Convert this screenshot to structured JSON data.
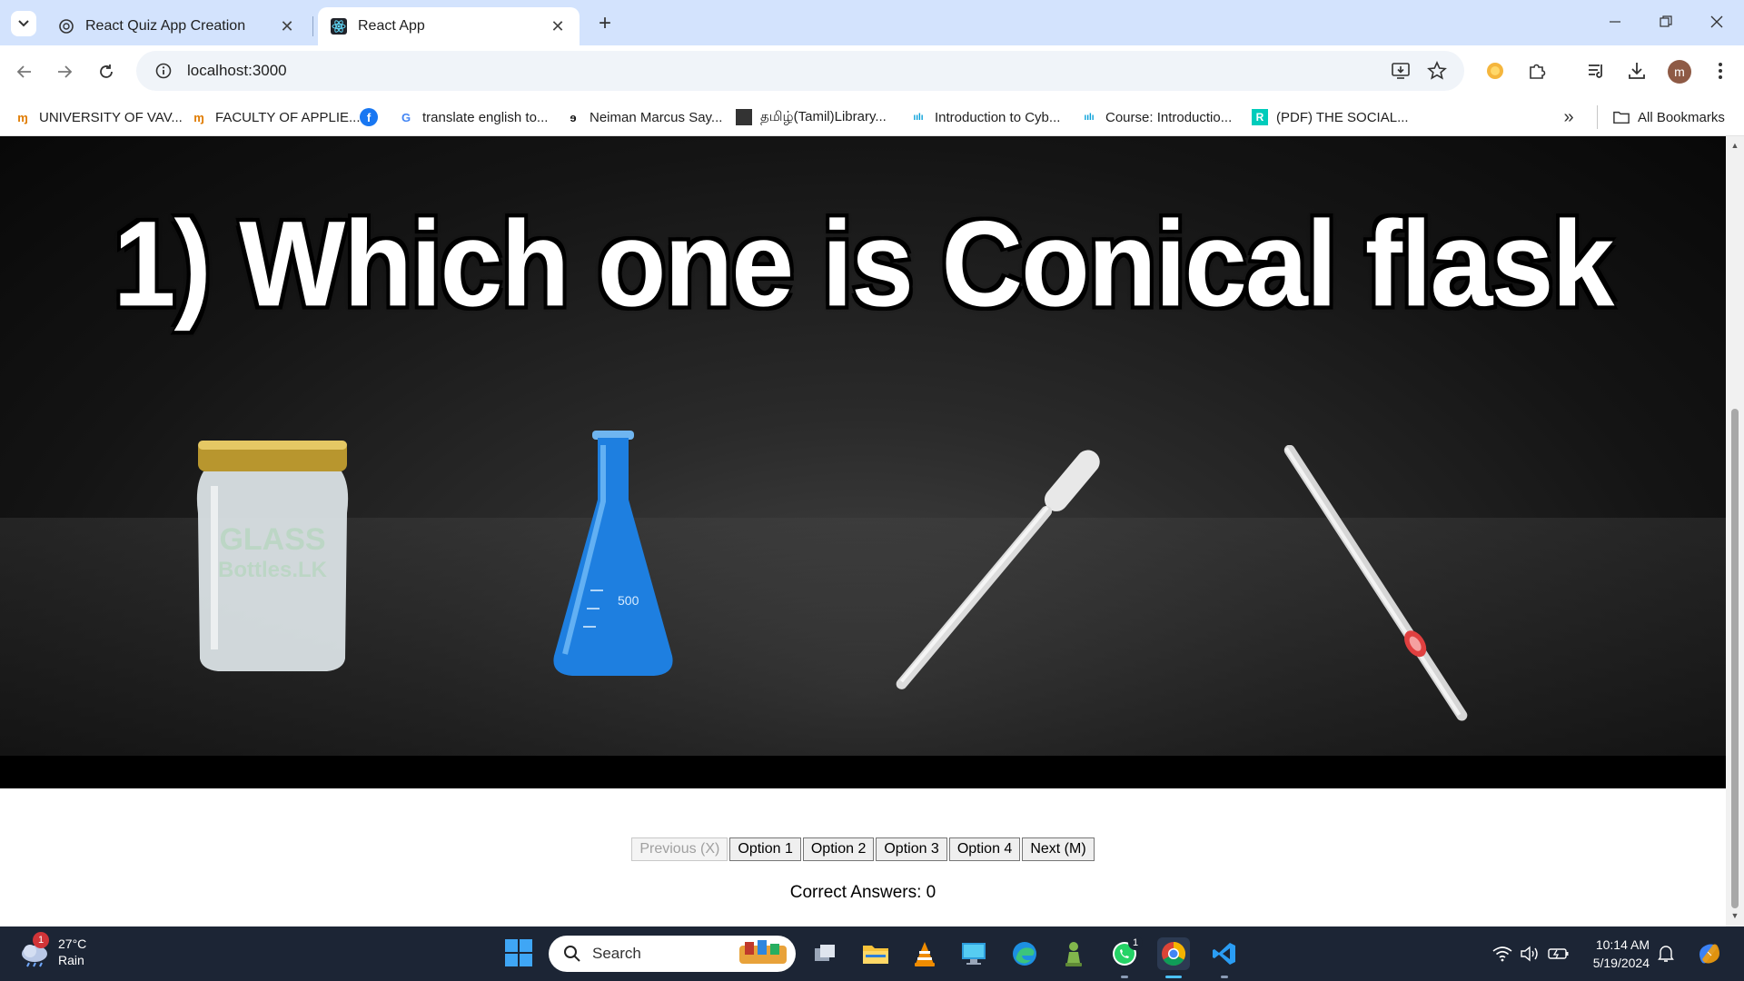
{
  "browser": {
    "tabs": [
      {
        "title": "React Quiz App Creation",
        "active": false
      },
      {
        "title": "React App",
        "active": true
      }
    ],
    "url": "localhost:3000",
    "bookmarks": [
      {
        "label": "UNIVERSITY OF VAV...",
        "icon": "university-icon"
      },
      {
        "label": "FACULTY OF APPLIE...",
        "icon": "university-icon"
      },
      {
        "label": "",
        "icon": "facebook-icon"
      },
      {
        "label": "translate english to...",
        "icon": "google-icon"
      },
      {
        "label": "Neiman Marcus Say...",
        "icon": "neiman-marcus-icon"
      },
      {
        "label": "தமிழ்(Tamil)Library...",
        "icon": "library-icon"
      },
      {
        "label": "Introduction to Cyb...",
        "icon": "cisco-icon"
      },
      {
        "label": "Course: Introductio...",
        "icon": "cisco-icon"
      },
      {
        "label": "(PDF) THE SOCIAL...",
        "icon": "researchgate-icon"
      }
    ],
    "all_bookmarks_label": "All Bookmarks",
    "profile_initial": "m"
  },
  "quiz": {
    "question": "1) Which one is Conical flask",
    "items": [
      "glass-jar",
      "conical-flask",
      "dropper-pipette",
      "glass-pipette"
    ],
    "image_text": {
      "jar_watermark_line1": "GLASS",
      "jar_watermark_line2": "Bottles.LK",
      "flask_volume": "500"
    },
    "buttons": {
      "previous": "Previous (X)",
      "option1": "Option 1",
      "option2": "Option 2",
      "option3": "Option 3",
      "option4": "Option 4",
      "next": "Next (M)"
    },
    "score_text": "Correct Answers: 0"
  },
  "taskbar": {
    "weather": {
      "temp": "27°C",
      "condition": "Rain",
      "badge": "1"
    },
    "search_placeholder": "Search",
    "whatsapp_badge": "1",
    "time": "10:14 AM",
    "date": "5/19/2024"
  },
  "colors": {
    "tabstrip": "#d3e3fd",
    "taskbar": "#1c2535",
    "flask_blue": "#1e7fe0",
    "jar_lid": "#b8962e"
  }
}
